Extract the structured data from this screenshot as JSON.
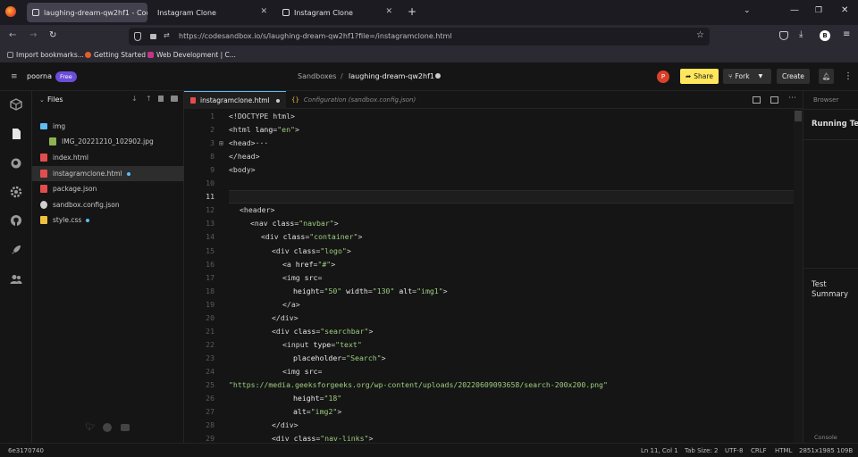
{
  "browser": {
    "tabs": [
      {
        "title": "laughing-dream-qw2hf1 - Cod"
      },
      {
        "title": "Instagram Clone"
      },
      {
        "title": "Instagram Clone"
      }
    ],
    "url": "https://codesandbox.io/s/laughing-dream-qw2hf1?file=/instagramclone.html",
    "profile_initial": "B",
    "bookmarks": [
      {
        "label": "Import bookmarks...",
        "color": "#9a9a9a"
      },
      {
        "label": "Getting Started",
        "color": "#e25f2a"
      },
      {
        "label": "Web Development | C...",
        "color": "#c13584"
      }
    ]
  },
  "header": {
    "user": "poorna",
    "plan": "Free",
    "breadcrumb_root": "Sandboxes",
    "breadcrumb_sep": "/",
    "sandbox_name": "laughing-dream-qw2hf1",
    "avatar_initial": "P",
    "share_label": "Share",
    "fork_label": "Fork",
    "create_label": "Create"
  },
  "explorer": {
    "title": "Files",
    "items": [
      {
        "name": "img",
        "type": "folder",
        "indent": 1,
        "color": "#5ebcf6"
      },
      {
        "name": "IMG_20221210_102902.jpg",
        "type": "image",
        "indent": 2,
        "color": "#8fb34f"
      },
      {
        "name": "index.html",
        "type": "html",
        "indent": 1,
        "color": "#e44d4d"
      },
      {
        "name": "instagramclone.html",
        "type": "html",
        "indent": 1,
        "color": "#e44d4d",
        "modified": true,
        "selected": true
      },
      {
        "name": "package.json",
        "type": "json",
        "indent": 1,
        "color": "#e44d4d"
      },
      {
        "name": "sandbox.config.json",
        "type": "config",
        "indent": 1,
        "color": "#cfcfcf"
      },
      {
        "name": "style.css",
        "type": "css",
        "indent": 1,
        "color": "#f0c040",
        "modified": true
      }
    ]
  },
  "editor": {
    "tabs": [
      {
        "label": "instagramclone.html",
        "active": true,
        "modified": true
      },
      {
        "label": "Configuration (sandbox.config.json)",
        "active": false
      }
    ],
    "lines": [
      {
        "n": "1",
        "indent": 0,
        "tokens": [
          {
            "c": "t",
            "v": "<!DOCTYPE html>"
          }
        ]
      },
      {
        "n": "2",
        "indent": 0,
        "tokens": [
          {
            "c": "t",
            "v": "<html "
          },
          {
            "c": "a",
            "v": "lang"
          },
          {
            "c": "t",
            "v": "="
          },
          {
            "c": "s",
            "v": "\"en\""
          },
          {
            "c": "t",
            "v": ">"
          }
        ]
      },
      {
        "n": "3",
        "indent": 0,
        "fold": true,
        "tokens": [
          {
            "c": "t",
            "v": "<head>"
          },
          {
            "c": "t",
            "v": "···"
          }
        ]
      },
      {
        "n": "8",
        "indent": 0,
        "tokens": [
          {
            "c": "t",
            "v": "</head>"
          }
        ]
      },
      {
        "n": "9",
        "indent": 0,
        "tokens": [
          {
            "c": "t",
            "v": "<body>"
          }
        ]
      },
      {
        "n": "10",
        "indent": 0,
        "tokens": []
      },
      {
        "n": "11",
        "indent": 0,
        "tokens": [],
        "current": true
      },
      {
        "n": "12",
        "indent": 1,
        "tokens": [
          {
            "c": "t",
            "v": "<header>"
          }
        ]
      },
      {
        "n": "13",
        "indent": 2,
        "tokens": [
          {
            "c": "t",
            "v": "<nav "
          },
          {
            "c": "a",
            "v": "class"
          },
          {
            "c": "t",
            "v": "="
          },
          {
            "c": "s",
            "v": "\"navbar\""
          },
          {
            "c": "t",
            "v": ">"
          }
        ]
      },
      {
        "n": "14",
        "indent": 3,
        "tokens": [
          {
            "c": "t",
            "v": "<div "
          },
          {
            "c": "a",
            "v": "class"
          },
          {
            "c": "t",
            "v": "="
          },
          {
            "c": "s",
            "v": "\"container\""
          },
          {
            "c": "t",
            "v": ">"
          }
        ]
      },
      {
        "n": "15",
        "indent": 4,
        "tokens": [
          {
            "c": "t",
            "v": "<div "
          },
          {
            "c": "a",
            "v": "class"
          },
          {
            "c": "t",
            "v": "="
          },
          {
            "c": "s",
            "v": "\"logo\""
          },
          {
            "c": "t",
            "v": ">"
          }
        ]
      },
      {
        "n": "16",
        "indent": 5,
        "tokens": [
          {
            "c": "t",
            "v": "<a "
          },
          {
            "c": "a",
            "v": "href"
          },
          {
            "c": "t",
            "v": "="
          },
          {
            "c": "s",
            "v": "\"#\""
          },
          {
            "c": "t",
            "v": ">"
          }
        ]
      },
      {
        "n": "17",
        "indent": 5,
        "tokens": [
          {
            "c": "t",
            "v": "<img "
          },
          {
            "c": "a",
            "v": "src"
          },
          {
            "c": "t",
            "v": "="
          }
        ]
      },
      {
        "n": "18",
        "indent": 6,
        "tokens": [
          {
            "c": "a",
            "v": "height"
          },
          {
            "c": "t",
            "v": "="
          },
          {
            "c": "s",
            "v": "\"50\""
          },
          {
            "c": "t",
            "v": " "
          },
          {
            "c": "a",
            "v": "width"
          },
          {
            "c": "t",
            "v": "="
          },
          {
            "c": "s",
            "v": "\"130\""
          },
          {
            "c": "t",
            "v": " "
          },
          {
            "c": "a",
            "v": "alt"
          },
          {
            "c": "t",
            "v": "="
          },
          {
            "c": "s",
            "v": "\"img1\""
          },
          {
            "c": "t",
            "v": ">"
          }
        ]
      },
      {
        "n": "19",
        "indent": 5,
        "tokens": [
          {
            "c": "t",
            "v": "</a>"
          }
        ]
      },
      {
        "n": "20",
        "indent": 4,
        "tokens": [
          {
            "c": "t",
            "v": "</div>"
          }
        ]
      },
      {
        "n": "21",
        "indent": 4,
        "tokens": [
          {
            "c": "t",
            "v": "<div "
          },
          {
            "c": "a",
            "v": "class"
          },
          {
            "c": "t",
            "v": "="
          },
          {
            "c": "s",
            "v": "\"searchbar\""
          },
          {
            "c": "t",
            "v": ">"
          }
        ]
      },
      {
        "n": "22",
        "indent": 5,
        "tokens": [
          {
            "c": "t",
            "v": "<input "
          },
          {
            "c": "a",
            "v": "type"
          },
          {
            "c": "t",
            "v": "="
          },
          {
            "c": "s",
            "v": "\"text\""
          }
        ]
      },
      {
        "n": "23",
        "indent": 6,
        "tokens": [
          {
            "c": "a",
            "v": "placeholder"
          },
          {
            "c": "t",
            "v": "="
          },
          {
            "c": "s",
            "v": "\"Search\""
          },
          {
            "c": "t",
            "v": ">"
          }
        ]
      },
      {
        "n": "24",
        "indent": 5,
        "tokens": [
          {
            "c": "t",
            "v": "<img "
          },
          {
            "c": "a",
            "v": "src"
          },
          {
            "c": "t",
            "v": "="
          }
        ]
      },
      {
        "n": "25",
        "indent": 0,
        "tokens": [
          {
            "c": "s",
            "v": "\"https://media.geeksforgeeks.org/wp-content/uploads/20220609093658/search-200x200.png\""
          }
        ]
      },
      {
        "n": "26",
        "indent": 6,
        "tokens": [
          {
            "c": "a",
            "v": "height"
          },
          {
            "c": "t",
            "v": "="
          },
          {
            "c": "s",
            "v": "\"18\""
          }
        ]
      },
      {
        "n": "27",
        "indent": 6,
        "tokens": [
          {
            "c": "a",
            "v": "alt"
          },
          {
            "c": "t",
            "v": "="
          },
          {
            "c": "s",
            "v": "\"img2\""
          },
          {
            "c": "t",
            "v": ">"
          }
        ]
      },
      {
        "n": "28",
        "indent": 4,
        "tokens": [
          {
            "c": "t",
            "v": "</div>"
          }
        ]
      },
      {
        "n": "29",
        "indent": 4,
        "tokens": [
          {
            "c": "t",
            "v": "<div "
          },
          {
            "c": "a",
            "v": "class"
          },
          {
            "c": "t",
            "v": "="
          },
          {
            "c": "s",
            "v": "\"nav-links\""
          },
          {
            "c": "t",
            "v": ">"
          }
        ]
      }
    ]
  },
  "right_panel": {
    "browser_tab": "Browser",
    "running_title": "Running Te",
    "test_summary_1": "Test",
    "test_summary_2": "Summary",
    "console_label": "Console"
  },
  "status": {
    "commit": "6e3170740",
    "cursor": "Ln 11, Col 1",
    "tab_size": "Tab Size: 2",
    "encoding": "UTF-8",
    "eol": "CRLF",
    "language": "HTML",
    "resolution": "2851x1985 109B"
  },
  "colors": {
    "share": "#ffe65c",
    "create": "#2f2f2f",
    "plan_badge": "#6b4dd8",
    "avatar": "#d9412b"
  }
}
